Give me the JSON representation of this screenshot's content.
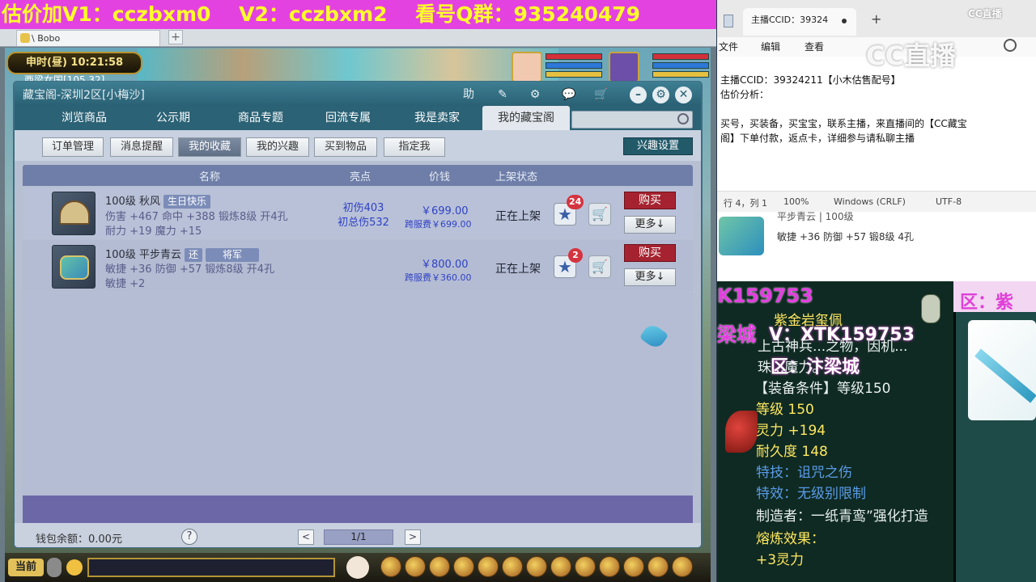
{
  "banner": {
    "part1": "估价加V1：cczbxm0",
    "part2": "V2：cczbxm2",
    "part3": "看号Q群：935240479"
  },
  "browser_tab": {
    "label": "\\ Bobo",
    "add": "+"
  },
  "hud": {
    "clock": "申时(昼)  10:21:58",
    "location": "西梁女国[105,32]"
  },
  "dialog": {
    "title": "藏宝阁-深圳2区[小梅沙]",
    "title_buttons": [
      "助",
      "✎",
      "⚙",
      "💬",
      "🛒"
    ],
    "window_buttons": [
      "–",
      "⚙",
      "✕"
    ],
    "nav_tabs": [
      "浏览商品",
      "公示期",
      "商品专题",
      "回流专属",
      "我是卖家",
      "我的藏宝阁"
    ],
    "active_tab": "我的藏宝阁",
    "search_placeholder": "",
    "sub_buttons": [
      "订单管理",
      "消息提醒",
      "我的收藏",
      "我的兴趣",
      "买到物品",
      "指定我"
    ],
    "active_sub": "我的收藏",
    "interest_button": "兴趣设置",
    "columns": [
      "名称",
      "亮点",
      "价钱",
      "上架状态"
    ],
    "items": [
      {
        "name": "100级  秋风",
        "tag": "生日快乐",
        "stats1": "伤害 +467  命中 +388  锻炼8级  开4孔",
        "stats2": "耐力 +19  魔力 +15",
        "highlight1": "初伤403",
        "highlight2": "初总伤532",
        "price": "￥699.00",
        "fee": "跨服费￥699.00",
        "status": "正在上架",
        "fav_count": "24",
        "buy": "购买",
        "more": "更多↓"
      },
      {
        "name": "100级  平步青云",
        "tag": "还",
        "tag2": "将军",
        "stats1": "敏捷 +36  防御 +57  锻炼8级  开4孔",
        "stats2": "敏捷 +2",
        "highlight1": "",
        "highlight2": "",
        "price": "￥800.00",
        "fee": "跨服费￥360.00",
        "status": "正在上架",
        "fav_count": "2",
        "buy": "购买",
        "more": "更多↓"
      }
    ],
    "wallet": "钱包余额：0.00元",
    "help": "?",
    "page_prev": "<",
    "page": "1/1",
    "page_next": ">"
  },
  "game_bar": {
    "channel": "当前"
  },
  "notepad": {
    "tab_title": "主播CCID：39324",
    "plus": "+",
    "menu": [
      "文件",
      "编辑",
      "查看"
    ],
    "lines": [
      "主播CCID：39324211【小木估售配号】",
      "估价分析：",
      "",
      "买号，买装备，买宝宝，联系主播，来直播间的【CC藏宝",
      "阁】下单付款，返点卡，详细参与请私聊主播"
    ],
    "status": [
      "行 4，列 1",
      "100%",
      "Windows (CRLF)",
      "UTF-8"
    ]
  },
  "cc_logo": "CC直播",
  "cc_logo_small": "CC直播",
  "list_item": {
    "title": "平步青云 | 100级",
    "stats": "敏捷 +36 防御 +57 锻8级 4孔"
  },
  "tooltip": {
    "wechat1": "K159753",
    "server1": "梁城",
    "wechat2": "V：XTK159753",
    "server2": "区：汴梁城",
    "item_name": "紫金岩玺佩",
    "desc": "上古神兵...之物，因机...",
    "desc2": "珠...魔力。",
    "req": "【装备条件】等级150",
    "level": "等级 150",
    "lingli": "灵力 +194",
    "durability": "耐久度 148",
    "skill": "特技：诅咒之伤",
    "effect": "特效：无级别限制",
    "maker": "制造者：一纸青鸾”强化打造",
    "smelt": "熔炼效果：",
    "smelt_val": "+3灵力",
    "right_header": "区：紫"
  }
}
